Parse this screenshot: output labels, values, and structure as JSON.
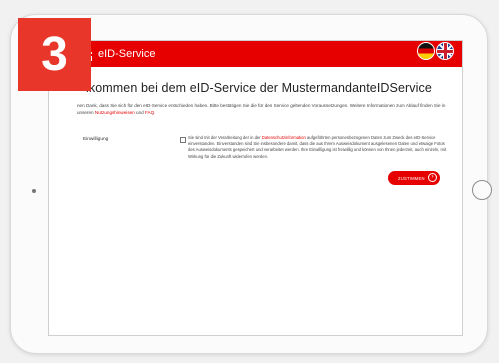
{
  "step_badge": "3",
  "header": {
    "service_title": "eID-Service",
    "flags": [
      "german-flag-icon",
      "uk-flag-icon"
    ]
  },
  "main": {
    "heading": "lkommen bei dem eID-Service der MustermandanteIDService",
    "intro_text": "nen Dank, dass Sie sich für den eID-Service entschieden haben. Bitte bestätigen Sie die für den Service geltenden Voraussetzungen. Weitere Informationen zum Ablauf finden Sie in unseren",
    "intro_link1": "Nutzungshinweisen",
    "intro_and": "und",
    "intro_link2": "FAQ",
    "intro_end": ".",
    "consent_label": "Einwilligung",
    "consent_text_1": "Sie sind mit der Verarbeitung der in der",
    "consent_link": "Datenschutzinformation",
    "consent_text_2": "aufgeführten personenbezogenen Daten zum Zweck des eID-Service einverstanden. Einverstanden sind Sie insbesondere damit, dass die aus Ihrem Ausweisdokument ausgelesenen Daten und etwaige Fotos des Ausweisdokuments gespeichert und verarbeitet werden. Ihre Einwilligung ist freiwillig und können von Ihnen jederzeit, auch einzeln, mit Wirkung für die Zukunft widerrufen werden.",
    "accept_button": "ZUSTIMMEN"
  },
  "colors": {
    "brand_red": "#e60000",
    "badge_red": "#e8362a"
  }
}
